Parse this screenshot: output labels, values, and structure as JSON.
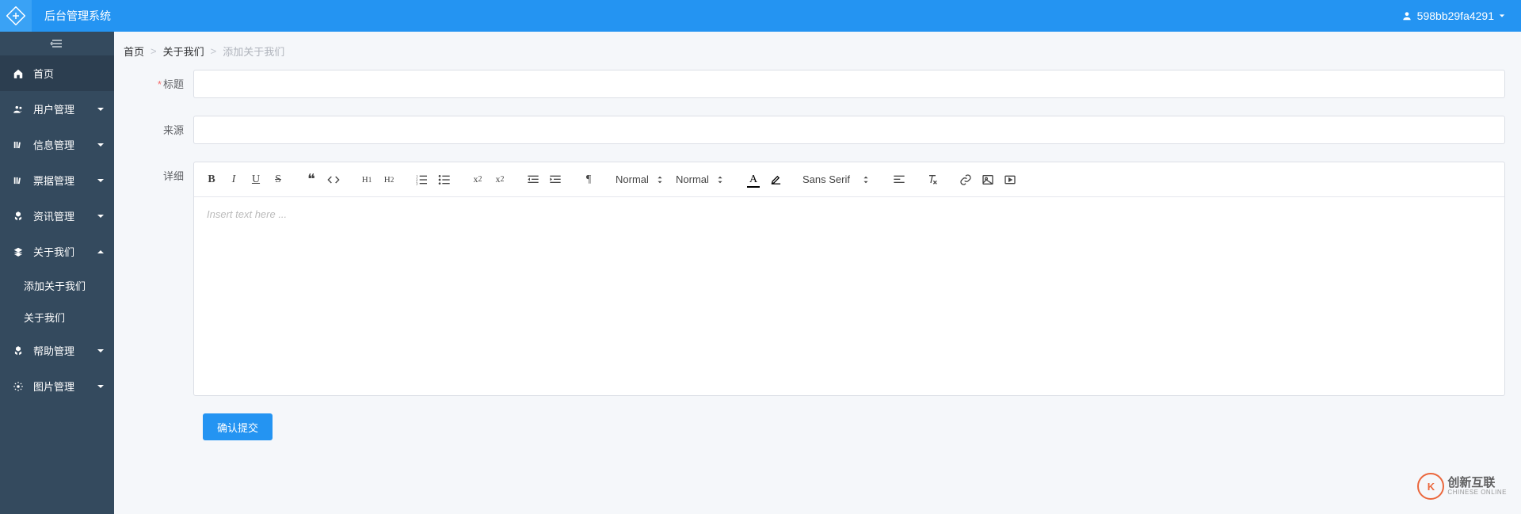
{
  "header": {
    "system_name": "后台管理系统",
    "user_name": "598bb29fa4291"
  },
  "sidebar": {
    "items": [
      {
        "icon": "home-icon",
        "label": "首页",
        "expandable": false,
        "active": true
      },
      {
        "icon": "users-icon",
        "label": "用户管理",
        "expandable": true,
        "open": false
      },
      {
        "icon": "books-icon",
        "label": "信息管理",
        "expandable": true,
        "open": false
      },
      {
        "icon": "books-icon",
        "label": "票据管理",
        "expandable": true,
        "open": false
      },
      {
        "icon": "cubes-icon",
        "label": "资讯管理",
        "expandable": true,
        "open": false
      },
      {
        "icon": "layers-icon",
        "label": "关于我们",
        "expandable": true,
        "open": true,
        "children": [
          "添加关于我们",
          "关于我们"
        ]
      },
      {
        "icon": "cubes-icon",
        "label": "帮助管理",
        "expandable": true,
        "open": false
      },
      {
        "icon": "gear-icon",
        "label": "图片管理",
        "expandable": true,
        "open": false
      }
    ]
  },
  "breadcrumb": {
    "items": [
      "首页",
      "关于我们",
      "添加关于我们"
    ]
  },
  "form": {
    "title": {
      "label": "标题",
      "required": true,
      "value": ""
    },
    "source": {
      "label": "来源",
      "required": false,
      "value": ""
    },
    "detail": {
      "label": "详细",
      "placeholder": "Insert text here ..."
    },
    "submit_label": "确认提交"
  },
  "editor_toolbar": {
    "size_select": "Normal",
    "header_select": "Normal",
    "font_select": "Sans Serif"
  },
  "watermark": {
    "brand": "创新互联",
    "sub": "CHINESE ONLINE"
  }
}
